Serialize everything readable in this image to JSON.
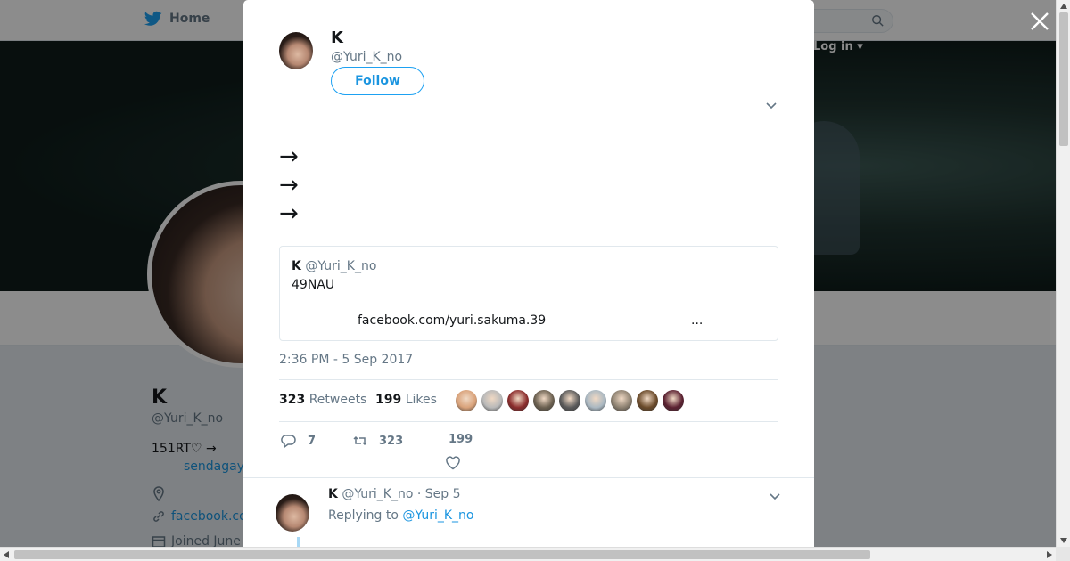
{
  "background": {
    "nav": {
      "home_label": "Home",
      "login_label": "Log in ▾"
    },
    "profile": {
      "name": "K",
      "handle": "@Yuri_K_no",
      "bio_line": "151RT♡ →",
      "bio_link": "sendagay",
      "website": "facebook.co",
      "joined": "Joined June"
    }
  },
  "modal": {
    "author": {
      "name": "K",
      "handle": "@Yuri_K_no"
    },
    "follow_label": "Follow",
    "tweet_text": "\n→\n→\n→",
    "quote": {
      "name": "K",
      "handle": "@Yuri_K_no",
      "text": "49NAU",
      "link": "facebook.com/yuri.sakuma.39",
      "ellipsis": "..."
    },
    "timestamp": "2:36 PM - 5 Sep 2017",
    "stats": {
      "retweets_count": "323",
      "retweets_label": "Retweets",
      "likes_count": "199",
      "likes_label": "Likes"
    },
    "actions": {
      "replies": "7",
      "retweets": "323",
      "likes": "199"
    },
    "reply": {
      "name": "K",
      "handle_date": "@Yuri_K_no · Sep 5",
      "replying_prefix": "Replying to",
      "replying_to": "@Yuri_K_no"
    }
  },
  "colors": {
    "accent": "#1da1f2",
    "link": "#1b95e0",
    "text": "#14171a",
    "muted": "#657786"
  },
  "likers": [
    "#d9a27a",
    "#b9b9b9",
    "#8a2b2b",
    "#6b6050",
    "#5a5a5a",
    "#aab8c2",
    "#8c8070",
    "#6a4a2a",
    "#5a2030"
  ]
}
